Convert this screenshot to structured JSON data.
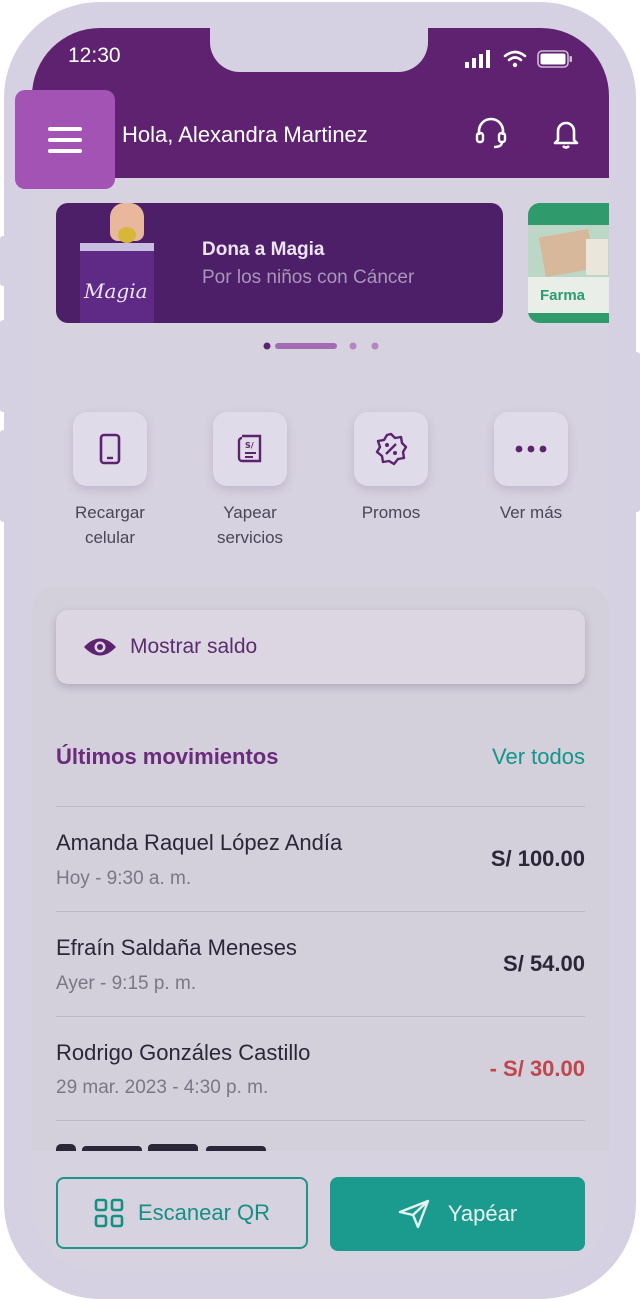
{
  "status_bar": {
    "time": "12:30"
  },
  "header": {
    "greeting": "Hola, Alexandra Martinez",
    "icons": [
      "menu-icon",
      "headset-icon",
      "bell-icon"
    ]
  },
  "banners": [
    {
      "title": "Dona a Magia",
      "subtitle": "Por los niños con Cáncer",
      "logo_text": "Magia"
    },
    {
      "logo_text": "Farma"
    }
  ],
  "quick_actions": [
    {
      "line1": "Recargar",
      "line2": "celular",
      "icon": "phone-icon"
    },
    {
      "line1": "Yapear",
      "line2": "servicios",
      "icon": "receipt-icon"
    },
    {
      "line1": "Promos",
      "line2": "",
      "icon": "discount-badge-icon"
    },
    {
      "line1": "Ver más",
      "line2": "",
      "icon": "more-dots-icon"
    }
  ],
  "balance": {
    "label": "Mostrar saldo",
    "icon": "eye-icon"
  },
  "movements": {
    "title": "Últimos movimientos",
    "see_all": "Ver todos",
    "items": [
      {
        "name": "Amanda Raquel López Andía",
        "date": "Hoy - 9:30 a. m.",
        "amount": "S/ 100.00",
        "negative": false
      },
      {
        "name": "Efraín Saldaña Meneses",
        "date": "Ayer - 9:15 p. m.",
        "amount": "S/ 54.00",
        "negative": false
      },
      {
        "name": "Rodrigo Gonzáles Castillo",
        "date": "29  mar.  2023 - 4:30 p. m.",
        "amount": "- S/ 30.00",
        "negative": true
      }
    ]
  },
  "actions": {
    "scan_label": "Escanear QR",
    "yape_label": "Yapéar"
  },
  "colors": {
    "primary": "#5f2270",
    "accent": "#1b9a8e",
    "negative": "#c0464c",
    "menu_highlight": "#a353b4"
  }
}
